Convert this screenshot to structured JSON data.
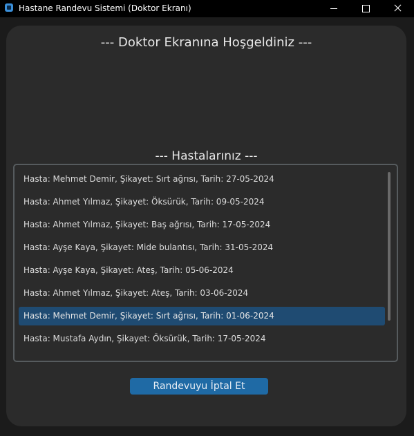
{
  "window": {
    "title": "Hastane Randevu Sistemi (Doktor Ekranı)",
    "controls": [
      "minimize",
      "maximize",
      "close"
    ]
  },
  "main": {
    "welcome_text": "--- Doktor Ekranına Hoşgeldiniz ---",
    "patients_title": "--- Hastalarınız ---",
    "appointments": [
      "Hasta: Mehmet Demir, Şikayet: Sırt ağrısı, Tarih: 27-05-2024",
      "Hasta: Ahmet Yılmaz, Şikayet: Öksürük, Tarih: 09-05-2024",
      "Hasta: Ahmet Yılmaz, Şikayet: Baş ağrısı, Tarih: 17-05-2024",
      "Hasta: Ayşe Kaya, Şikayet: Mide bulantısı, Tarih: 31-05-2024",
      "Hasta: Ayşe Kaya, Şikayet: Ateş, Tarih: 05-06-2024",
      "Hasta: Ahmet Yılmaz, Şikayet: Ateş, Tarih: 03-06-2024",
      "Hasta: Mehmet Demir, Şikayet: Sırt ağrısı, Tarih: 01-06-2024",
      "Hasta: Mustafa Aydın, Şikayet: Öksürük, Tarih: 17-05-2024"
    ],
    "selected_index": 6,
    "cancel_button_label": "Randevuyu İptal Et"
  },
  "colors": {
    "background": "#1b1b1b",
    "panel": "#2b2b2b",
    "accent": "#1f6aa5",
    "selection": "#1f4b72"
  }
}
